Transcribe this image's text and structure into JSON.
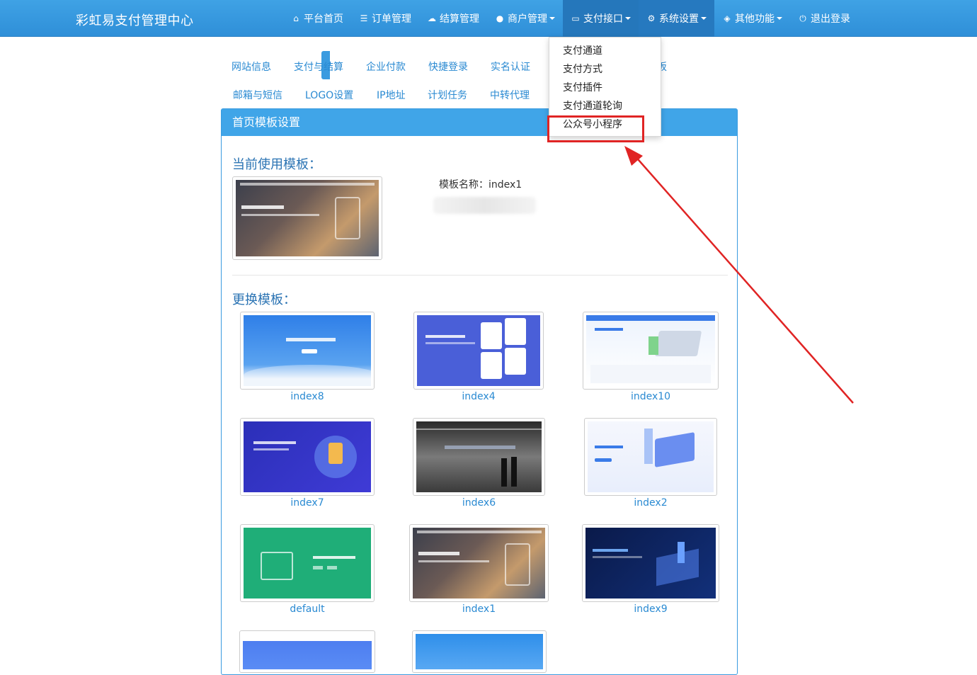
{
  "brand": "彩虹易支付管理中心",
  "nav": [
    {
      "label": "平台首页",
      "icon": "home-icon",
      "caret": false
    },
    {
      "label": "订单管理",
      "icon": "list-icon",
      "caret": false
    },
    {
      "label": "结算管理",
      "icon": "cloud-icon",
      "caret": false
    },
    {
      "label": "商户管理",
      "icon": "user-icon",
      "caret": true
    },
    {
      "label": "支付接口",
      "icon": "card-icon",
      "caret": true
    },
    {
      "label": "系统设置",
      "icon": "gear-icon",
      "caret": true
    },
    {
      "label": "其他功能",
      "icon": "box-icon",
      "caret": true
    },
    {
      "label": "退出登录",
      "icon": "power-icon",
      "caret": false
    }
  ],
  "dropdown": [
    "支付通道",
    "支付方式",
    "支付插件",
    "支付通道轮询",
    "公众号小程序"
  ],
  "tabs_row1": [
    "网站信息",
    "支付与结算",
    "企业付款",
    "快捷登录",
    "实名认证",
    "板"
  ],
  "tabs_row2": [
    "邮箱与短信",
    "LOGO设置",
    "IP地址",
    "计划任务",
    "中转代理"
  ],
  "panel_title": "首页模板设置",
  "current_title": "当前使用模板：",
  "current_name": "模板名称：index1",
  "change_title": "更换模板：",
  "templates": [
    "index8",
    "index4",
    "index10",
    "index7",
    "index6",
    "index2",
    "default",
    "index1",
    "index9"
  ],
  "colors": {
    "accent": "#3a9be0",
    "highlight": "#e02424"
  }
}
